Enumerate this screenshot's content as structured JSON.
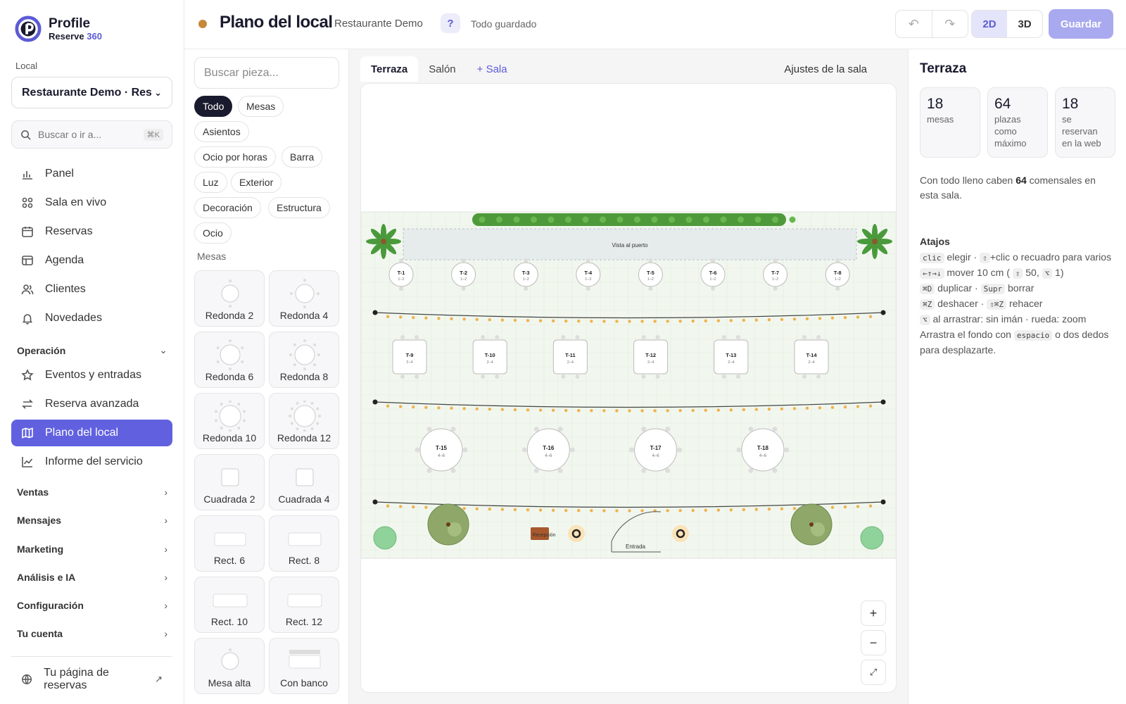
{
  "brand": {
    "name": "Profile",
    "product": "Reserve",
    "product_suffix": "360"
  },
  "sidebar": {
    "local_label": "Local",
    "local_value": "Restaurante Demo · Restaurante Demo",
    "search_placeholder": "Buscar o ir a...",
    "search_shortcut": "⌘K",
    "items": [
      {
        "label": "Panel",
        "icon": "bar-chart-icon"
      },
      {
        "label": "Sala en vivo",
        "icon": "grid-icon"
      },
      {
        "label": "Reservas",
        "icon": "calendar-icon"
      },
      {
        "label": "Agenda",
        "icon": "table-icon"
      },
      {
        "label": "Clientes",
        "icon": "users-icon"
      },
      {
        "label": "Novedades",
        "icon": "bell-icon"
      }
    ],
    "operation_group": "Operación",
    "operation_items": [
      {
        "label": "Eventos y entradas",
        "icon": "star-icon"
      },
      {
        "label": "Reserva avanzada",
        "icon": "swap-icon"
      },
      {
        "label": "Plano del local",
        "icon": "map-icon",
        "active": true
      },
      {
        "label": "Informe del servicio",
        "icon": "line-chart-icon"
      }
    ],
    "groups": [
      "Ventas",
      "Mensajes",
      "Marketing",
      "Análisis e IA",
      "Configuración",
      "Tu cuenta"
    ],
    "booking_page": "Tu página de reservas"
  },
  "toolbar": {
    "status_color": "#c8883a",
    "title": "Plano del local",
    "subtitle": "Restaurante Demo",
    "help": "?",
    "saved": "Todo guardado",
    "undo": "↶",
    "redo": "↷",
    "view_2d": "2D",
    "view_3d": "3D",
    "save": "Guardar"
  },
  "palette": {
    "search_placeholder": "Buscar pieza...",
    "filters": [
      "Todo",
      "Mesas",
      "Asientos",
      "Ocio por horas",
      "Barra",
      "Luz",
      "Exterior",
      "Decoración",
      "Estructura",
      "Ocio"
    ],
    "section": "Mesas",
    "pieces": [
      "Redonda 2",
      "Redonda 4",
      "Redonda 6",
      "Redonda 8",
      "Redonda 10",
      "Redonda 12",
      "Cuadrada 2",
      "Cuadrada 4",
      "Rect. 6",
      "Rect. 8",
      "Rect. 10",
      "Rect. 12",
      "Mesa alta",
      "Con banco"
    ]
  },
  "canvas": {
    "tabs": [
      "Terraza",
      "Salón",
      "+ Sala"
    ],
    "room_settings": "Ajustes de la sala",
    "view_label": "Vista al puerto",
    "reception_label": "Recepción",
    "entrance_label": "Entrada",
    "row1": [
      {
        "id": "T-1",
        "cap": "1–2"
      },
      {
        "id": "T-2",
        "cap": "1–2"
      },
      {
        "id": "T-3",
        "cap": "1–2"
      },
      {
        "id": "T-4",
        "cap": "1–2"
      },
      {
        "id": "T-5",
        "cap": "1–2"
      },
      {
        "id": "T-6",
        "cap": "1–2"
      },
      {
        "id": "T-7",
        "cap": "1–2"
      },
      {
        "id": "T-8",
        "cap": "1–2"
      }
    ],
    "row2": [
      {
        "id": "T-9",
        "cap": "2–4"
      },
      {
        "id": "T-10",
        "cap": "2–4"
      },
      {
        "id": "T-11",
        "cap": "2–4"
      },
      {
        "id": "T-12",
        "cap": "2–4"
      },
      {
        "id": "T-13",
        "cap": "2–4"
      },
      {
        "id": "T-14",
        "cap": "2–4"
      }
    ],
    "row3": [
      {
        "id": "T-15",
        "cap": "4–6"
      },
      {
        "id": "T-16",
        "cap": "4–6"
      },
      {
        "id": "T-17",
        "cap": "4–6"
      },
      {
        "id": "T-18",
        "cap": "4–6"
      }
    ],
    "zoom_in": "+",
    "zoom_out": "−",
    "fit": "⤢"
  },
  "panel": {
    "title": "Terraza",
    "stats": [
      {
        "n": "18",
        "l": "mesas"
      },
      {
        "n": "64",
        "l": "plazas como máximo"
      },
      {
        "n": "18",
        "l": "se reservan en la web"
      }
    ],
    "note_pre": "Con todo lleno caben ",
    "note_num": "64",
    "note_post": " comensales en esta sala.",
    "shortcuts_title": "Atajos",
    "sc1_k": "clic",
    "sc1_a": "elegir ·",
    "sc1_k2": "⇧",
    "sc1_b": "+clic o recuadro para varios",
    "sc2_k": "←↑→↓",
    "sc2_a": "mover 10 cm (",
    "sc2_k2": "⇧",
    "sc2_b": "50,",
    "sc2_k3": "⌥",
    "sc2_c": "1)",
    "sc3_k": "⌘D",
    "sc3_a": "duplicar ·",
    "sc3_k2": "Supr",
    "sc3_b": "borrar",
    "sc4_k": "⌘Z",
    "sc4_a": "deshacer ·",
    "sc4_k2": "⇧⌘Z",
    "sc4_b": "rehacer",
    "sc5_k": "⌥",
    "sc5_a": "al arrastrar: sin imán · rueda: zoom",
    "sc6_a": "Arrastra el fondo con",
    "sc6_k": "espacio",
    "sc6_b": "o dos dedos para desplazarte."
  }
}
